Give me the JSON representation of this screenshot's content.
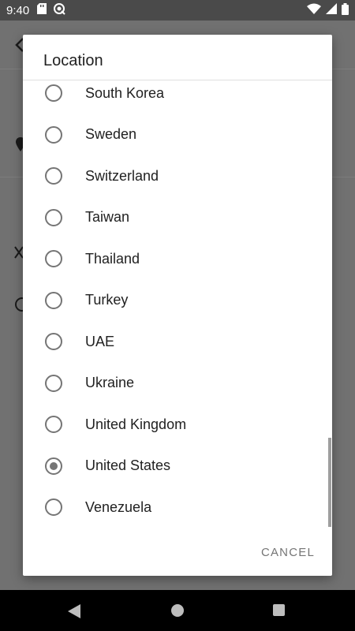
{
  "status_bar": {
    "time": "9:40",
    "icons": [
      "sd-card-icon",
      "sync-icon",
      "wifi-icon",
      "signal-icon",
      "battery-icon"
    ]
  },
  "dialog": {
    "title": "Location",
    "options": [
      {
        "label": "South Korea",
        "selected": false
      },
      {
        "label": "Sweden",
        "selected": false
      },
      {
        "label": "Switzerland",
        "selected": false
      },
      {
        "label": "Taiwan",
        "selected": false
      },
      {
        "label": "Thailand",
        "selected": false
      },
      {
        "label": "Turkey",
        "selected": false
      },
      {
        "label": "UAE",
        "selected": false
      },
      {
        "label": "Ukraine",
        "selected": false
      },
      {
        "label": "United Kingdom",
        "selected": false
      },
      {
        "label": "United States",
        "selected": true
      },
      {
        "label": "Venezuela",
        "selected": false
      }
    ],
    "cancel_label": "CANCEL"
  },
  "nav_bar": {
    "icons": [
      "back-icon",
      "home-icon",
      "recents-icon"
    ]
  }
}
